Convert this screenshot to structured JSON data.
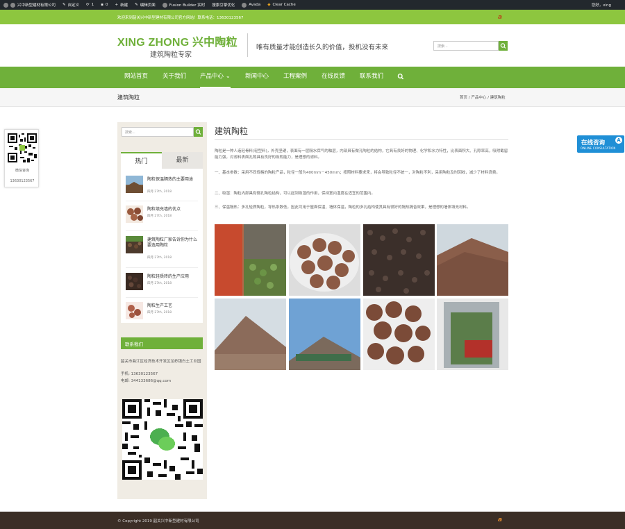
{
  "adminbar": {
    "site": "兴中新型建材有限公司",
    "customize": "自定义",
    "updates": "1",
    "comments": "0",
    "new": "新建",
    "edit": "编辑页面",
    "fusion": "Fusion Builder 实时",
    "seo": "搜索引擎优化",
    "avada": "Avada",
    "cache": "Clear Cache",
    "user": "您好，xing"
  },
  "topbar": {
    "welcome": "欢迎来到韶关兴中新型建材有限公司官方网站！联系电话：13630123567",
    "logo_text": "a"
  },
  "header": {
    "brand": "XING ZHONG 兴中陶粒",
    "subtitle": "建筑陶粒专家",
    "slogan": "唯有质量才能创造长久的价值，投机没有未来",
    "search_placeholder": "搜索..."
  },
  "nav": {
    "items": [
      "网站首页",
      "关于我们",
      "产品中心 ⌄",
      "新闻中心",
      "工程案例",
      "在线反馈",
      "联系我们"
    ],
    "active_index": 2
  },
  "breadcrumb": {
    "title": "建筑陶粒",
    "trail": "首页 / 产品中心 / 建筑陶粒"
  },
  "float_qr": {
    "label": "微信咨询",
    "tel": "13630123567"
  },
  "consult": {
    "title": "在线咨询",
    "subtitle": "ONLINE CONSULTATION",
    "badge": "A"
  },
  "sidebar": {
    "search_placeholder": "搜索...",
    "tab_hot": "热门",
    "tab_new": "最新",
    "posts": [
      {
        "title": "陶粒保温隔热的主要用途",
        "date": "四月 27th, 2018"
      },
      {
        "title": "陶粒填充墙的优点",
        "date": "四月 27th, 2018"
      },
      {
        "title": "建筑陶粒厂家告诉你为什么要选用陶粒",
        "date": "四月 27th, 2018"
      },
      {
        "title": "陶粒轻质砖的生产应用",
        "date": "四月 27th, 2018"
      },
      {
        "title": "陶粒生产工艺",
        "date": "四月 27th, 2018"
      }
    ],
    "contact_heading": "联系我们",
    "address": "韶关市曲江区经济技术开发区龙岭镇白土工业园",
    "phone": "手机: 13630123567",
    "email": "电邮: 344133686@qq.com"
  },
  "main": {
    "title": "建筑陶粒",
    "paragraphs": [
      "陶粒是一种人造轻骨料(轻型料)，外壳坚硬，表面有一层隔水保气的釉层，内部具有微孔陶粒的结构，它具有良好的物理、化学和水力特性，比表面积大、孔隙率高，吸附截留能力强，对滤料表面孔隙具有良好的吸附能力，是理想的滤料。",
      "一、基本参数：采用不同规格的陶粒产品，粒径一般为400mm－450mm；按照材料要求来，将会导致粒径不统一，对陶粒不利，采用陶粒及时回收，减少了材料浪费。",
      "二、吸湿：陶粒内部具有微孔陶粒结构，可以起到吸湿的作用，保持室内湿度在适宜的范围内。",
      "三、保温隔热：多孔轻质陶粒，导热系数低，因此可用于屋面保温、墙体保温，陶粒的多孔结构使其具有很好的隔热隔音效果，是理想的墙体填充材料。"
    ]
  },
  "footer": {
    "copyright": "© Copyright 2019 韶关兴中新型建材有限公司",
    "logo_text": "a"
  },
  "colors": {
    "brand_green": "#6fb03a",
    "top_green": "#8dc63f",
    "footer_brown": "#3b2e26",
    "consult_blue": "#1f8fd6"
  }
}
